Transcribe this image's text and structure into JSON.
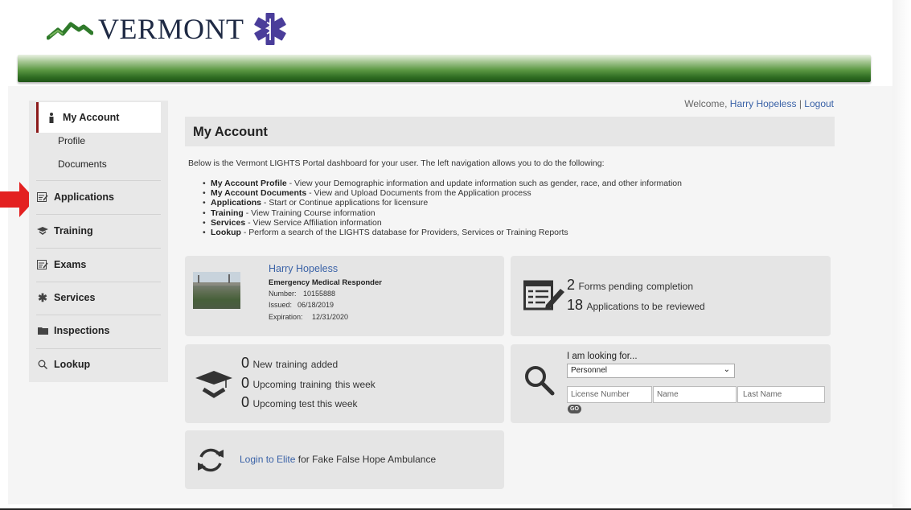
{
  "brand": {
    "wordmark": "VERMONT"
  },
  "sidebar": {
    "items": [
      {
        "label": "My Account",
        "icon": "person-icon"
      },
      {
        "label": "Profile"
      },
      {
        "label": "Documents"
      },
      {
        "label": "Applications",
        "icon": "form-icon"
      },
      {
        "label": "Training",
        "icon": "graduation-cap-icon"
      },
      {
        "label": "Exams",
        "icon": "form-icon"
      },
      {
        "label": "Services",
        "icon": "asterisk-icon"
      },
      {
        "label": "Inspections",
        "icon": "folder-icon"
      },
      {
        "label": "Lookup",
        "icon": "search-icon"
      }
    ]
  },
  "header": {
    "welcome": "Welcome,",
    "user": "Harry Hopeless",
    "sep": "|",
    "logout": "Logout"
  },
  "page": {
    "title": "My Account",
    "intro": "Below is the Vermont LIGHTS Portal dashboard for your user. The left navigation allows you to do the following:",
    "bullets": [
      {
        "title": "My Account Profile",
        "text": " - View your Demographic information and update information such as gender, race, and other information"
      },
      {
        "title": "My Account Documents",
        "text": " - View and Upload Documents from the Application process"
      },
      {
        "title": "Applications",
        "text": " - Start or Continue applications for licensure"
      },
      {
        "title": "Training",
        "text": " - View Training Course information"
      },
      {
        "title": "Services",
        "text": " - View Service Affiliation information"
      },
      {
        "title": "Lookup",
        "text": " - Perform a search of the LIGHTS database for Providers, Services or Training Reports"
      }
    ]
  },
  "profile_card": {
    "name": "Harry Hopeless",
    "role": "Emergency Medical Responder",
    "number_label": "Number:",
    "number": "10155888",
    "issued_label": "Issued:",
    "issued": "06/18/2019",
    "expiration_label": "Expiration:",
    "expiration": "12/31/2020"
  },
  "forms_card": {
    "forms_count": "2",
    "forms_text": "Forms pending",
    "forms_link": "completion",
    "apps_count": "18",
    "apps_text": "Applications to be",
    "apps_link": "reviewed"
  },
  "training_card": {
    "new_count": "0",
    "new_pre": "New",
    "new_link": "training",
    "new_post": "added",
    "upcoming_count": "0",
    "upcoming_pre": "Upcoming",
    "upcoming_link": "training",
    "upcoming_post": "this week",
    "test_count": "0",
    "test_text": "Upcoming test this week"
  },
  "lookup_card": {
    "heading": "I am looking for...",
    "selected": "Personnel",
    "license_placeholder": "License Number",
    "name_placeholder": "Name",
    "last_name_placeholder": "Last Name",
    "go": "GO"
  },
  "elite_card": {
    "link": "Login to Elite",
    "text": "for Fake False Hope Ambulance"
  },
  "colors": {
    "accent_link": "#3a62a7",
    "active_bar": "#8b1a1a",
    "arrow": "#e32020"
  }
}
